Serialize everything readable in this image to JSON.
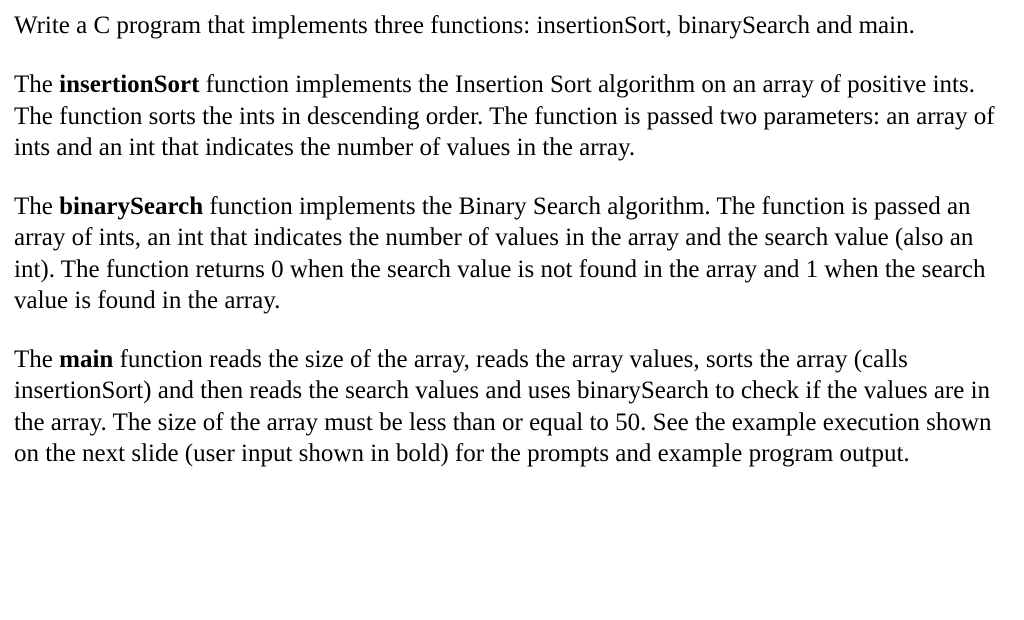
{
  "para1": "Write a C program that implements three functions: insertionSort, binarySearch and main.",
  "para2": {
    "pre": "The ",
    "bold": "insertionSort",
    "post": " function implements the Insertion Sort algorithm on an array of positive ints. The function sorts the ints in descending order. The function is passed two parameters: an array of ints and an int that indicates the number of values in the array."
  },
  "para3": {
    "pre": "The ",
    "bold": "binarySearch",
    "post": " function implements the Binary Search algorithm. The function is passed an array of ints, an int that indicates the number of values in the array and the search value (also an int). The function returns 0 when the search value is not found in the array and 1 when the search value is found in the array."
  },
  "para4": {
    "pre": "The ",
    "bold": "main",
    "post": " function reads the size of the array, reads the array values, sorts the array (calls insertionSort) and then reads the search values and uses binarySearch to check if the values are in the array. The size of the array must be less than or equal to 50. See the example execution shown on the next slide (user input shown in bold) for the prompts and example program output."
  }
}
